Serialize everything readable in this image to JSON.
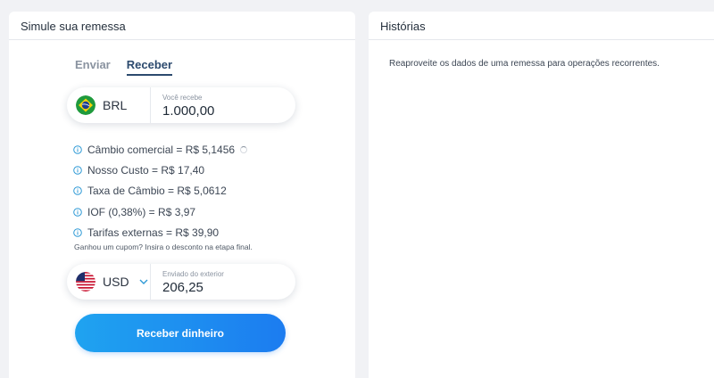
{
  "simulator": {
    "title": "Simule sua remessa",
    "tabs": [
      {
        "label": "Enviar",
        "active": false
      },
      {
        "label": "Receber",
        "active": true
      }
    ],
    "receive": {
      "currency": "BRL",
      "currency_flag_icon": "brazil-flag-icon",
      "label": "Você recebe",
      "value": "1.000,00"
    },
    "info": [
      {
        "text": "Câmbio comercial = R$ 5,1456"
      },
      {
        "text": "Nosso Custo = R$ 17,40"
      },
      {
        "text": "Taxa de Câmbio = R$ 5,0612"
      },
      {
        "text": "IOF (0,38%) = R$ 3,97"
      },
      {
        "text": "Tarifas externas = R$ 39,90"
      }
    ],
    "coupon_note": "Ganhou um cupom? Insira o desconto na etapa final.",
    "send": {
      "currency": "USD",
      "currency_flag_icon": "usa-flag-icon",
      "label": "Enviado do exterior",
      "value": "206,25"
    },
    "cta_label": "Receber dinheiro"
  },
  "history": {
    "title": "Histórias",
    "description": "Reaproveite os dados de uma remessa para operações recorrentes."
  },
  "colors": {
    "accent": "#1c7cf0",
    "accent_light": "#1fa3f0",
    "tab_active": "#2c4a6e",
    "info_icon": "#2f9ad6",
    "background": "#f1f2f5"
  }
}
